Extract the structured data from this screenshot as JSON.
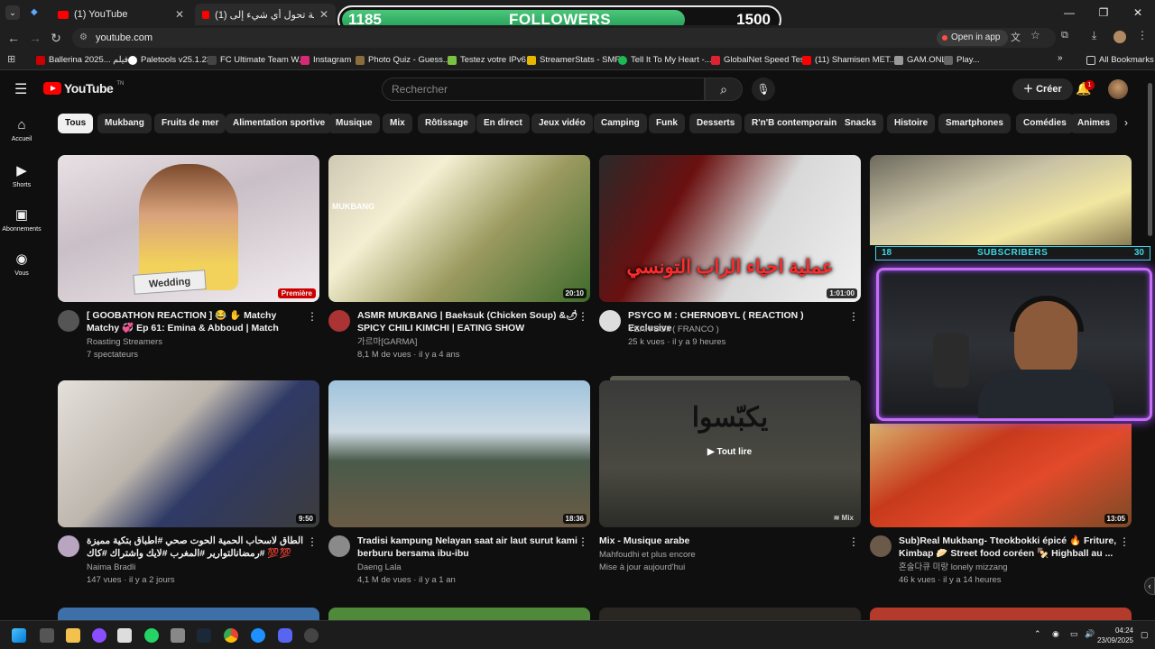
{
  "browser": {
    "tabs": [
      {
        "title": "(1) YouTube"
      },
      {
        "title": "(1) آلة خرافية تحول أي شيء إلى ..."
      }
    ],
    "url": "youtube.com",
    "open_in_app": "Open in app",
    "bookmarks": [
      "Ballerina 2025... فيلم",
      "Paletools v25.1.23",
      "FC Ultimate Team W...",
      "Instagram",
      "Photo Quiz - Guess...",
      "Testez votre IPv6.",
      "StreamerStats - SMF...",
      "Tell It To My Heart -...",
      "GlobalNet Speed Test",
      "(11) Shamisen MET...",
      "GAM.ONL",
      "Play..."
    ],
    "all_bookmarks": "All Bookmarks"
  },
  "followers_overlay": {
    "current": "1185",
    "label": "FOLLOWERS",
    "goal": "1500",
    "progress": 0.79,
    "color": "#2fb866"
  },
  "subscribers_overlay": {
    "current": "18",
    "label": "SUBSCRIBERS",
    "goal": "30",
    "color": "#38d8e8"
  },
  "youtube": {
    "logo_text": "YouTube",
    "logo_sup": "TN",
    "search_placeholder": "Rechercher",
    "create_label": "Créer",
    "notifications_count": "1",
    "sidebar": [
      {
        "icon": "home-icon",
        "label": "Accueil"
      },
      {
        "icon": "shorts-icon",
        "label": "Shorts"
      },
      {
        "icon": "subscriptions-icon",
        "label": "Abonnements"
      },
      {
        "icon": "you-icon",
        "label": "Vous"
      }
    ],
    "chips": [
      "Tous",
      "Mukbang",
      "Fruits de mer",
      "Alimentation sportive",
      "Musique",
      "Mix",
      "Rôtissage",
      "En direct",
      "Jeux vidéo",
      "Camping",
      "Funk",
      "Desserts",
      "R'n'B contemporain",
      "Snacks",
      "Histoire",
      "Smartphones",
      "Comédies",
      "Animes"
    ],
    "videos": [
      {
        "title": "[ GOOBATHON REACTION ] 😂 ✋ Matchy Matchy 💞 Ep 61: Emina & Abboud | Match",
        "channel": "Roasting Streamers",
        "meta": "7 spectateurs",
        "badge": "Première",
        "thumb_text": "Wedding"
      },
      {
        "title": "ASMR MUKBANG | Baeksuk (Chicken Soup) &🌶 SPICY CHILI KIMCHI | EATING SHOW",
        "channel": "가르마[GARMA]",
        "meta": "8,1 M de vues · il y a 4 ans",
        "duration": "20:10",
        "thumb_text": "MUKBANG"
      },
      {
        "title": "PSYCO M : CHERNOBYL ( REACTION ) Exclusive",
        "channel": "YEAH BOii ( FRANCO )",
        "meta": "25 k vues · il y a 9 heures",
        "duration": "1:01:00",
        "thumb_text": "عملية احياء الراب التونسي"
      },
      {
        "title": "",
        "channel": "",
        "meta": ""
      },
      {
        "title": "الطاق لاسحاب الحمية الحوت صحي #اطباق بتكية مميزة 💯💯 #رمضانالتوارير #المغرب #لايك واشتراك #كاك",
        "channel": "Naima Bradli",
        "meta": "147 vues · il y a 2 jours",
        "duration": "9:50"
      },
      {
        "title": "Tradisi kampung Nelayan saat air laut surut kami berburu bersama ibu-ibu",
        "channel": "Daeng Lala",
        "meta": "4,1 M de vues · il y a 1 an",
        "duration": "18:36"
      },
      {
        "title": "Mix - Musique arabe",
        "channel": "Mahfoudhi et plus encore",
        "meta": "Mise à jour aujourd'hui",
        "mix_label": "Mix",
        "play_all": "Tout lire",
        "thumb_text": "يكبّسوا"
      },
      {
        "title": "Sub)Real Mukbang- Tteokbokki épicé 🔥 Friture, Kimbap 🥟 Street food coréen 🍢 Highball au ...",
        "channel": "혼술다큐 미랑 lonely mizzang",
        "meta": "46 k vues · il y a 14 heures",
        "duration": "13:05"
      }
    ]
  },
  "taskbar": {
    "time": "04:24",
    "date": "23/09/2025"
  }
}
